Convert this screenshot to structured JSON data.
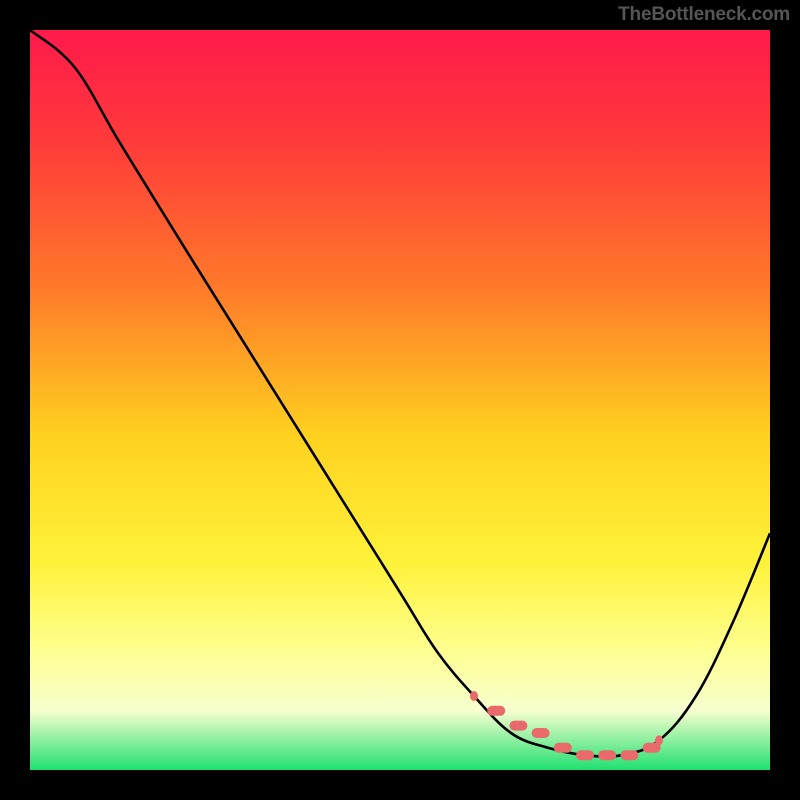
{
  "watermark": "TheBottleneck.com",
  "chart_data": {
    "type": "line",
    "title": "",
    "xlabel": "",
    "ylabel": "",
    "xlim": [
      0,
      100
    ],
    "ylim": [
      0,
      100
    ],
    "gradient_stops": [
      {
        "offset": 0,
        "color": "#ff1a4b"
      },
      {
        "offset": 15,
        "color": "#ff3a3a"
      },
      {
        "offset": 35,
        "color": "#ff7a2a"
      },
      {
        "offset": 55,
        "color": "#ffd21f"
      },
      {
        "offset": 72,
        "color": "#fff23a"
      },
      {
        "offset": 83,
        "color": "#ffff8a"
      },
      {
        "offset": 92,
        "color": "#f7ffcf"
      },
      {
        "offset": 100,
        "color": "#20e070"
      }
    ],
    "series": [
      {
        "name": "bottleneck-curve",
        "color": "#000000",
        "x": [
          0,
          6,
          12,
          20,
          30,
          40,
          50,
          55,
          60,
          65,
          70,
          75,
          80,
          85,
          90,
          95,
          100
        ],
        "values": [
          100,
          95,
          85,
          72,
          56,
          40,
          24,
          16,
          10,
          5,
          3,
          2,
          2,
          4,
          10,
          20,
          32
        ]
      }
    ],
    "markers": {
      "name": "highlight-segment",
      "color": "#e86a6a",
      "x": [
        60,
        63,
        66,
        69,
        72,
        75,
        78,
        81,
        84,
        85
      ],
      "values": [
        10,
        8,
        6,
        5,
        3,
        2,
        2,
        2,
        3,
        4
      ]
    }
  }
}
